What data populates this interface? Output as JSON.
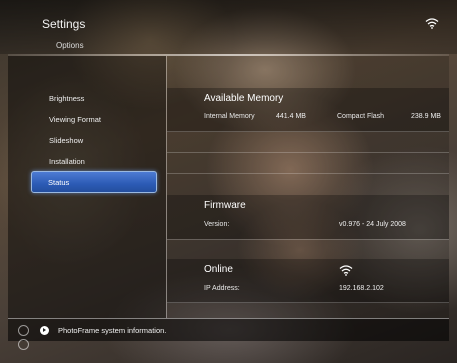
{
  "header": {
    "title": "Settings",
    "subtitle": "Options",
    "wifi_icon": "wifi-icon"
  },
  "menu": {
    "items": [
      {
        "label": "Brightness"
      },
      {
        "label": "Viewing Format"
      },
      {
        "label": "Slideshow"
      },
      {
        "label": "Installation"
      },
      {
        "label": "Status",
        "selected": true
      }
    ]
  },
  "info": {
    "memory": {
      "title": "Available Memory",
      "internal_label": "Internal Memory",
      "internal_value": "441.4 MB",
      "cf_label": "Compact Flash",
      "cf_value": "238.9 MB"
    },
    "firmware": {
      "title": "Firmware",
      "version_label": "Version:",
      "version_value": "v0.976 - 24 July 2008"
    },
    "online": {
      "title": "Online",
      "ip_label": "IP Address:",
      "ip_value": "192.168.2.102",
      "wifi_icon": "wifi-icon"
    }
  },
  "footer": {
    "help_text": "PhotoFrame system information."
  },
  "colors": {
    "selected_bg": "#3a68c4",
    "selected_border": "#9ab8e0"
  }
}
